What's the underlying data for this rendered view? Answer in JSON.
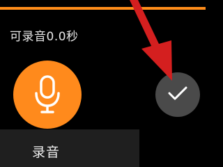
{
  "hint": {
    "text": "可录音0.0秒"
  },
  "record": {
    "label": "录音",
    "icon": "microphone-icon"
  },
  "confirm": {
    "icon": "check-icon"
  },
  "annotation": {
    "icon": "red-arrow-pointer"
  },
  "colors": {
    "accent": "#ff8a1c",
    "top_bar": "#ff8d1a",
    "confirm_bg": "#4a4a4a",
    "label_panel": "#1f1f1f",
    "arrow": "#d41f1f"
  }
}
